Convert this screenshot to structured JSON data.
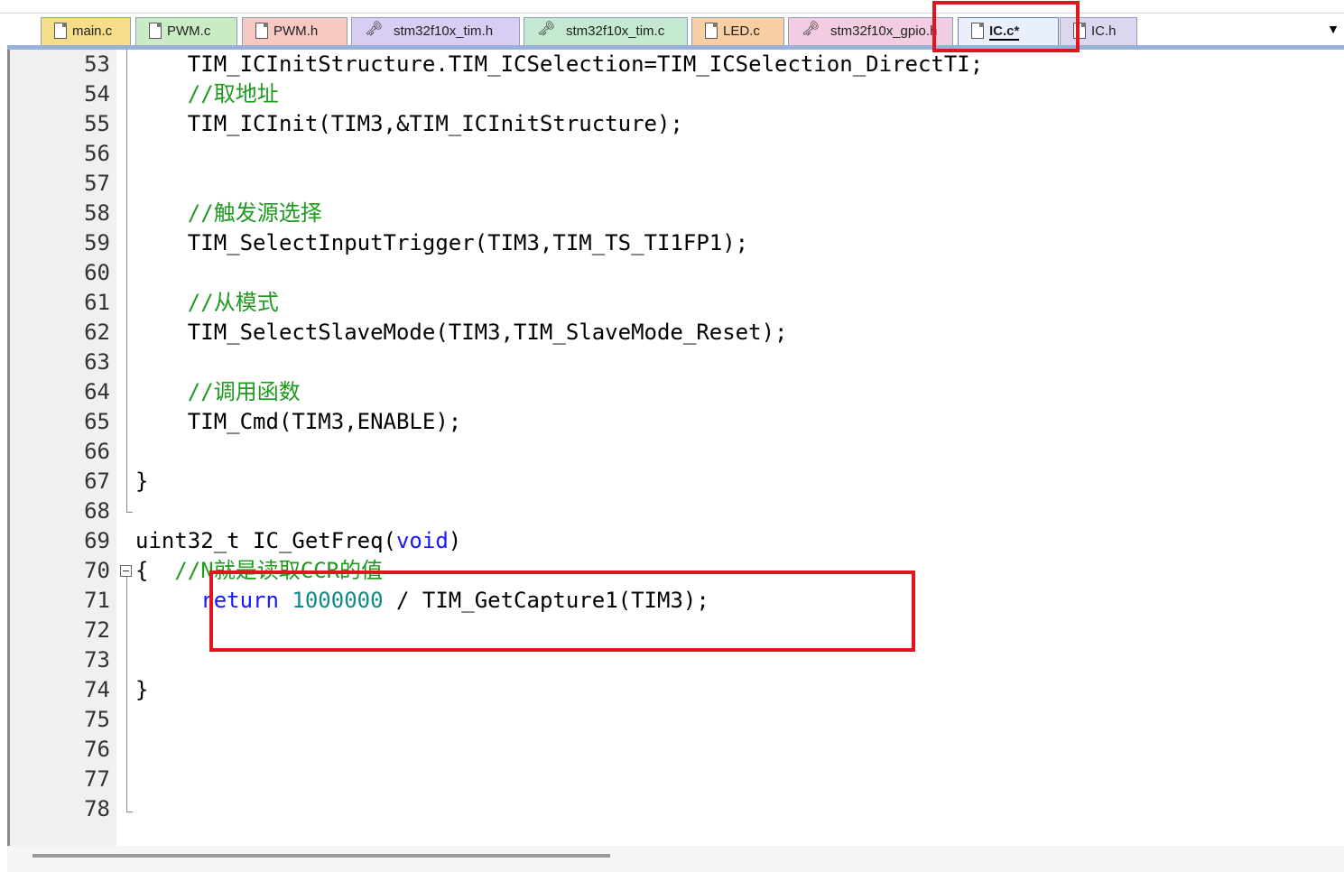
{
  "tabs": [
    {
      "label": "main.c",
      "icon": "document-icon",
      "color": "#f6dd8a"
    },
    {
      "label": "PWM.c",
      "icon": "document-icon",
      "color": "#c9ecc5"
    },
    {
      "label": "PWM.h",
      "icon": "document-icon",
      "color": "#f6c9c2"
    },
    {
      "label": "stm32f10x_tim.h",
      "icon": "key-document-icon",
      "color": "#d8cdf2"
    },
    {
      "label": "stm32f10x_tim.c",
      "icon": "key-document-icon",
      "color": "#c4e9d0"
    },
    {
      "label": "LED.c",
      "icon": "document-icon",
      "color": "#f7cfa2"
    },
    {
      "label": "stm32f10x_gpio.h",
      "icon": "key-document-icon",
      "color": "#f2cde2"
    },
    {
      "label": "IC.c*",
      "icon": "document-icon",
      "color": "#eaf0fb",
      "active": true
    },
    {
      "label": "IC.h",
      "icon": "document-icon",
      "color": "#dcd7ef"
    }
  ],
  "tabs_dropdown": "▼",
  "lines": [
    {
      "n": "53",
      "segs": [
        {
          "t": "    TIM_ICInitStructure.TIM_ICSelection=TIM_ICSelection_DirectTI;",
          "c": "plain"
        }
      ]
    },
    {
      "n": "54",
      "segs": [
        {
          "t": "    //取地址",
          "c": "cmt"
        }
      ]
    },
    {
      "n": "55",
      "segs": [
        {
          "t": "    TIM_ICInit(TIM3,&TIM_ICInitStructure);",
          "c": "plain"
        }
      ]
    },
    {
      "n": "56",
      "segs": []
    },
    {
      "n": "57",
      "segs": []
    },
    {
      "n": "58",
      "segs": [
        {
          "t": "    //触发源选择",
          "c": "cmt"
        }
      ]
    },
    {
      "n": "59",
      "segs": [
        {
          "t": "    TIM_SelectInputTrigger(TIM3,TIM_TS_TI1FP1);",
          "c": "plain"
        }
      ]
    },
    {
      "n": "60",
      "segs": []
    },
    {
      "n": "61",
      "segs": [
        {
          "t": "    //从模式",
          "c": "cmt"
        }
      ]
    },
    {
      "n": "62",
      "segs": [
        {
          "t": "    TIM_SelectSlaveMode(TIM3,TIM_SlaveMode_Reset);",
          "c": "plain"
        }
      ]
    },
    {
      "n": "63",
      "segs": []
    },
    {
      "n": "64",
      "segs": [
        {
          "t": "    //调用函数",
          "c": "cmt"
        }
      ]
    },
    {
      "n": "65",
      "segs": [
        {
          "t": "    TIM_Cmd(TIM3,ENABLE);",
          "c": "plain"
        }
      ]
    },
    {
      "n": "66",
      "segs": []
    },
    {
      "n": "67",
      "segs": [
        {
          "t": "}",
          "c": "plain"
        }
      ]
    },
    {
      "n": "68",
      "segs": []
    },
    {
      "n": "69",
      "segs": [
        {
          "t": "uint32_t IC_GetFreq(",
          "c": "plain"
        },
        {
          "t": "void",
          "c": "kw"
        },
        {
          "t": ")",
          "c": "plain"
        }
      ]
    },
    {
      "n": "70",
      "segs": [
        {
          "t": "{  ",
          "c": "plain"
        },
        {
          "t": "//N就是读取CCR的值",
          "c": "cmt"
        }
      ]
    },
    {
      "n": "71",
      "segs": [
        {
          "t": "     ",
          "c": "plain"
        },
        {
          "t": "return",
          "c": "kw"
        },
        {
          "t": " ",
          "c": "plain"
        },
        {
          "t": "1000000",
          "c": "num"
        },
        {
          "t": " / TIM_GetCapture1(TIM3);",
          "c": "plain"
        }
      ]
    },
    {
      "n": "72",
      "segs": []
    },
    {
      "n": "73",
      "segs": []
    },
    {
      "n": "74",
      "segs": [
        {
          "t": "}",
          "c": "plain"
        }
      ]
    },
    {
      "n": "75",
      "segs": []
    },
    {
      "n": "76",
      "segs": []
    },
    {
      "n": "77",
      "segs": []
    },
    {
      "n": "78",
      "segs": []
    }
  ],
  "highlight_color": "#e0151e"
}
